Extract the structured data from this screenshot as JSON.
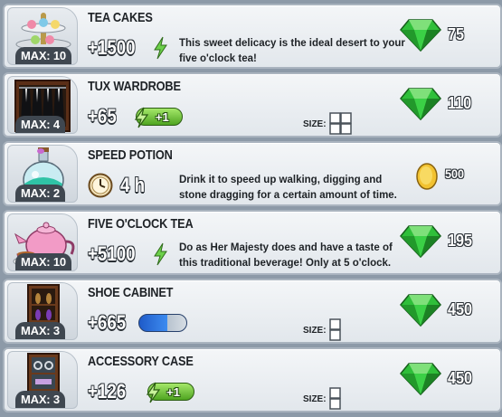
{
  "items": [
    {
      "name": "TEA CAKES",
      "max": "MAX: 10",
      "stat_kind": "energy",
      "stat": "+1500",
      "desc": "This sweet delicacy is the ideal desert to your five o'clock tea!",
      "currency": "gem",
      "price": "75",
      "size": null,
      "thumb_icon": "tea-cakes-icon"
    },
    {
      "name": "TUX WARDROBE",
      "max": "MAX: 4",
      "stat_kind": "energy-badge",
      "stat": "+65",
      "badge": "+1",
      "desc": "",
      "currency": "gem",
      "price": "110",
      "size": "2x2",
      "size_label": "SIZE:",
      "thumb_icon": "tux-wardrobe-icon"
    },
    {
      "name": "SPEED POTION",
      "max": "MAX: 2",
      "stat_kind": "time",
      "stat": "4 h",
      "desc": "Drink it to speed up walking, digging and stone dragging for a certain amount of time.",
      "currency": "coin",
      "price": "500",
      "size": null,
      "thumb_icon": "speed-potion-icon"
    },
    {
      "name": "FIVE O'CLOCK TEA",
      "max": "MAX: 10",
      "stat_kind": "energy",
      "stat": "+5100",
      "desc": "Do as Her Majesty does and have a taste of this traditional beverage! Only at 5 o'clock.",
      "currency": "gem",
      "price": "195",
      "size": null,
      "thumb_icon": "teapot-icon"
    },
    {
      "name": "SHOE CABINET",
      "max": "MAX: 3",
      "stat_kind": "progress",
      "stat": "+665",
      "progress": 0.6,
      "desc": "",
      "currency": "gem",
      "price": "450",
      "size": "1x2",
      "size_label": "SIZE:",
      "thumb_icon": "shoe-cabinet-icon"
    },
    {
      "name": "ACCESSORY CASE",
      "max": "MAX: 3",
      "stat_kind": "energy-badge",
      "stat": "+126",
      "badge": "+1",
      "desc": "",
      "currency": "gem",
      "price": "450",
      "size": "1x2",
      "size_label": "SIZE:",
      "thumb_icon": "accessory-case-icon"
    }
  ],
  "colors": {
    "gem": "#2fbf3a",
    "coin": "#f2c230",
    "energy": "#5cc83a",
    "row_bg": "#eef1f4"
  }
}
